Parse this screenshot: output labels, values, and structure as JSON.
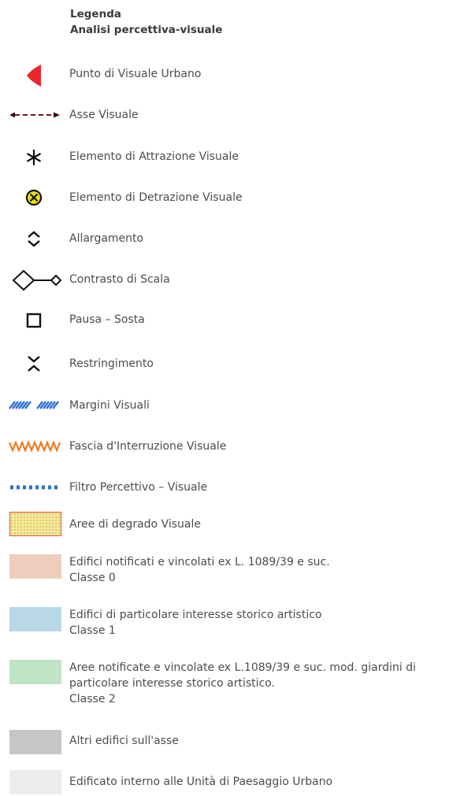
{
  "legend": {
    "title": "Legenda",
    "subtitle": "Analisi percettiva-visuale",
    "items": [
      {
        "icon": "red-half-eye-icon",
        "label": "Punto di Visuale Urbano",
        "color": "#e8262c"
      },
      {
        "icon": "dashed-arrow-icon",
        "label": "Asse Visuale",
        "color": "#6b1a1a"
      },
      {
        "icon": "asterisk-icon",
        "label": "Elemento di Attrazione Visuale",
        "color": "#111111"
      },
      {
        "icon": "circled-x-icon",
        "label": "Elemento di Detrazione Visuale",
        "color": "#f2e200"
      },
      {
        "icon": "diverging-chevrons-icon",
        "label": "Allargamento",
        "color": "#111111"
      },
      {
        "icon": "diamond-link-icon",
        "label": "Contrasto di Scala",
        "color": "#111111"
      },
      {
        "icon": "square-outline-icon",
        "label": "Pausa – Sosta",
        "color": "#111111"
      },
      {
        "icon": "converging-chevrons-icon",
        "label": "Restringimento",
        "color": "#111111"
      },
      {
        "icon": "blue-hatch-icon",
        "label": "Margini Visuali",
        "color": "#2f6fd6"
      },
      {
        "icon": "orange-zigzag-icon",
        "label": "Fascia d'Interruzione Visuale",
        "color": "#f07a22"
      },
      {
        "icon": "blue-dotted-line-icon",
        "label": "Filtro Percettivo – Visuale",
        "color": "#2a6fd0"
      },
      {
        "icon": "yellow-dotted-swatch",
        "label": "Aree di degrado Visuale",
        "color": "#f5e9a0",
        "border": "#e8502a"
      },
      {
        "icon": "pink-swatch",
        "label": "Edifici notificati e vincolati ex L. 1089/39 e suc.\nClasse 0",
        "color": "#efcdbd"
      },
      {
        "icon": "blue-swatch",
        "label": "Edifici di particolare interesse storico artistico\nClasse 1",
        "color": "#b8d8e6"
      },
      {
        "icon": "green-swatch",
        "label": "Aree notificate e vincolate ex L.1089/39 e suc. mod. giardini di\nparticolare interesse storico artistico.\nClasse 2",
        "color": "#bfe5c4"
      },
      {
        "icon": "grey-swatch",
        "label": "Altri edifici sull'asse",
        "color": "#c6c6c6"
      },
      {
        "icon": "light-grey-swatch",
        "label": "Edificato interno alle Unità di Paesaggio Urbano",
        "color": "#ececec"
      }
    ]
  }
}
